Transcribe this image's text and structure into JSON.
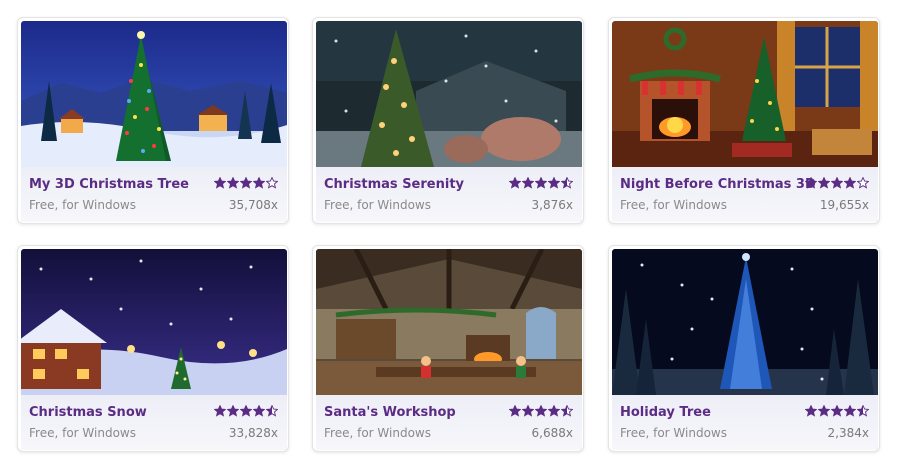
{
  "colors": {
    "title": "#5b2c83",
    "star": "#5b2c83",
    "meta": "#8a8a8a"
  },
  "items": [
    {
      "title": "My 3D Christmas Tree",
      "license": "Free, for Windows",
      "downloads": "35,708x",
      "rating_stars": 4.0
    },
    {
      "title": "Christmas Serenity",
      "license": "Free, for Windows",
      "downloads": "3,876x",
      "rating_stars": 4.5
    },
    {
      "title": "Night Before Christmas 3D",
      "license": "Free, for Windows",
      "downloads": "19,655x",
      "rating_stars": 4.0
    },
    {
      "title": "Christmas Snow",
      "license": "Free, for Windows",
      "downloads": "33,828x",
      "rating_stars": 4.5
    },
    {
      "title": "Santa's Workshop",
      "license": "Free, for Windows",
      "downloads": "6,688x",
      "rating_stars": 4.5
    },
    {
      "title": "Holiday Tree",
      "license": "Free, for Windows",
      "downloads": "2,384x",
      "rating_stars": 4.5
    }
  ]
}
